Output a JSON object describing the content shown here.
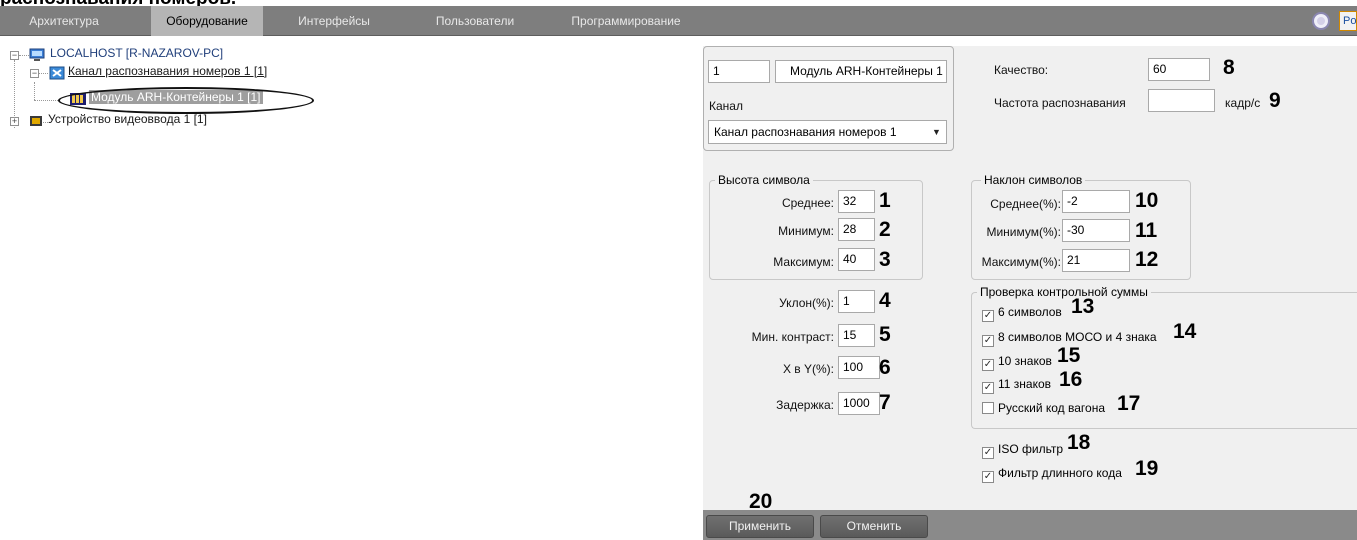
{
  "caption_fragment": "распознавания номеров.",
  "tabs": [
    {
      "label": "Архитектура",
      "active": false
    },
    {
      "label": "Оборудование",
      "active": true
    },
    {
      "label": "Интерфейсы",
      "active": false
    },
    {
      "label": "Пользователи",
      "active": false
    },
    {
      "label": "Программирование",
      "active": false
    }
  ],
  "topbar_edge_text": "Po",
  "tree": {
    "root": "LOCALHOST [R-NAZAROV-PC]",
    "channel": "Канал распознавания номеров 1 [1]",
    "module": "Модуль ARH-Контейнеры 1 [1]",
    "video_device": "Устройство видеоввода 1 [1]"
  },
  "header": {
    "id_value": "1",
    "name_value": "Модуль ARH-Контейнеры 1",
    "channel_label": "Канал",
    "channel_select": "Канал распознавания номеров 1",
    "quality_label": "Качество:",
    "quality_value": "60",
    "freq_label": "Частота распознавания",
    "freq_value": "",
    "freq_unit": "кадр/с"
  },
  "symbol_height": {
    "title": "Высота символа",
    "avg_label": "Среднее:",
    "avg_value": "32",
    "min_label": "Минимум:",
    "min_value": "28",
    "max_label": "Максимум:",
    "max_value": "40"
  },
  "misc": {
    "slope_label": "Уклон(%):",
    "slope_value": "1",
    "contrast_label": "Мин. контраст:",
    "contrast_value": "15",
    "xy_label": "X в Y(%):",
    "xy_value": "100",
    "delay_label": "Задержка:",
    "delay_value": "1000"
  },
  "symbol_tilt": {
    "title": "Наклон символов",
    "avg_label": "Среднее(%):",
    "avg_value": "-2",
    "min_label": "Минимум(%):",
    "min_value": "-30",
    "max_label": "Максимум(%):",
    "max_value": "21"
  },
  "checksum": {
    "title": "Проверка контрольной суммы",
    "items": [
      {
        "label": "6 символов",
        "checked": true
      },
      {
        "label": "8 символов МОСО и 4 знака",
        "checked": true
      },
      {
        "label": "10 знаков",
        "checked": true
      },
      {
        "label": "11 знаков",
        "checked": true
      },
      {
        "label": "Русский код вагона",
        "checked": false
      }
    ]
  },
  "filters": [
    {
      "label": "ISO фильтр",
      "checked": true
    },
    {
      "label": "Фильтр длинного кода",
      "checked": true
    }
  ],
  "annotations": [
    "1",
    "2",
    "3",
    "4",
    "5",
    "6",
    "7",
    "8",
    "9",
    "10",
    "11",
    "12",
    "13",
    "14",
    "15",
    "16",
    "17",
    "18",
    "19",
    "20"
  ],
  "buttons": {
    "apply": "Применить",
    "cancel": "Отменить"
  },
  "icons": {
    "gear": "gear-icon",
    "computer": "computer-icon",
    "channel": "channel-icon",
    "module": "module-icon",
    "video": "video-device-icon"
  }
}
